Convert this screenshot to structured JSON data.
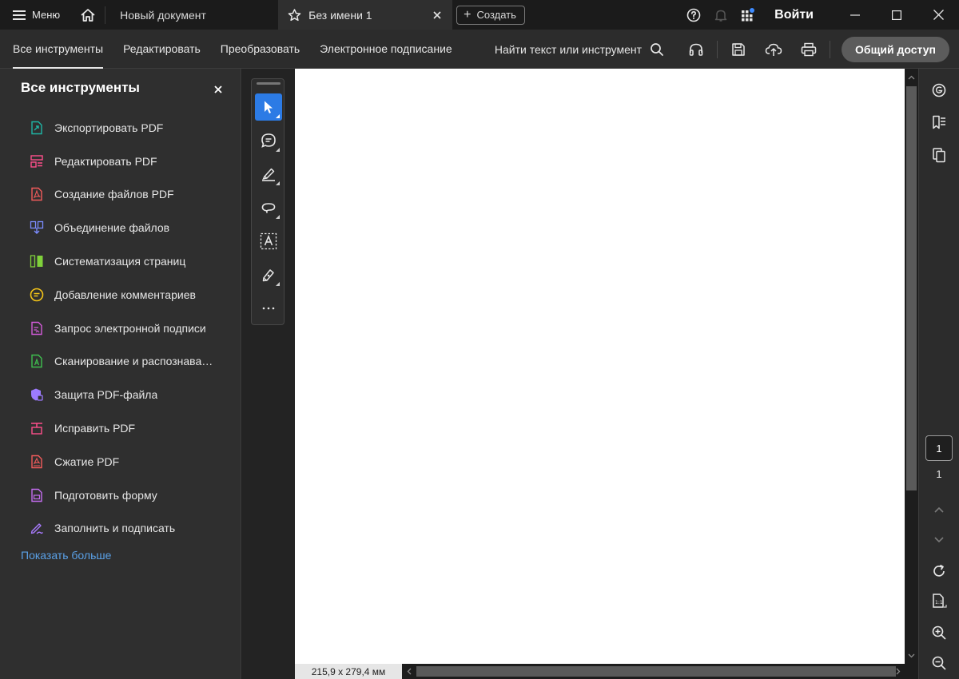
{
  "titlebar": {
    "menu_label": "Меню",
    "tabs": [
      {
        "label": "Новый документ",
        "active": false
      },
      {
        "label": "Без имени 1",
        "active": true
      }
    ],
    "create_label": "Создать",
    "login_label": "Войти",
    "icons": [
      "menu-icon",
      "home-icon",
      "star-icon",
      "close-icon",
      "help-icon",
      "bell-icon",
      "apps-icon",
      "minimize-icon",
      "maximize-icon",
      "window-close-icon"
    ]
  },
  "toolbar": {
    "tabs": [
      "Все инструменты",
      "Редактировать",
      "Преобразовать",
      "Электронное подписание"
    ],
    "active_tab": "Все инструменты",
    "find_label": "Найти текст или инструмент",
    "share_label": "Общий доступ",
    "icons": [
      "search-icon",
      "headphones-icon",
      "save-icon",
      "cloud-upload-icon",
      "print-icon"
    ]
  },
  "left_panel": {
    "title": "Все инструменты",
    "items": [
      {
        "label": "Экспортировать PDF",
        "icon": "export-pdf-icon",
        "color": "#1fb5a5"
      },
      {
        "label": "Редактировать PDF",
        "icon": "edit-pdf-icon",
        "color": "#ff4f8b"
      },
      {
        "label": "Создание файлов PDF",
        "icon": "create-pdf-icon",
        "color": "#f25b5b"
      },
      {
        "label": "Объединение файлов",
        "icon": "combine-files-icon",
        "color": "#7b8cff"
      },
      {
        "label": "Систематизация страниц",
        "icon": "organize-pages-icon",
        "color": "#7fd13b"
      },
      {
        "label": "Добавление комментариев",
        "icon": "comment-icon",
        "color": "#f5c518"
      },
      {
        "label": "Запрос электронной подписи",
        "icon": "request-signature-icon",
        "color": "#d35bd9"
      },
      {
        "label": "Сканирование и распознавание текста",
        "icon": "scan-ocr-icon",
        "color": "#3fbf4f"
      },
      {
        "label": "Защита PDF-файла",
        "icon": "protect-pdf-icon",
        "color": "#9d7bff"
      },
      {
        "label": "Исправить PDF",
        "icon": "redact-pdf-icon",
        "color": "#ff4f8b"
      },
      {
        "label": "Сжатие PDF",
        "icon": "compress-pdf-icon",
        "color": "#f25b5b"
      },
      {
        "label": "Подготовить форму",
        "icon": "prepare-form-icon",
        "color": "#c46df0"
      },
      {
        "label": "Заполнить и подписать",
        "icon": "fill-sign-icon",
        "color": "#a97bff"
      }
    ],
    "show_more_label": "Показать больше"
  },
  "tool_strip": {
    "tools": [
      "select-cursor-icon",
      "comment-bubble-icon",
      "highlighter-icon",
      "lasso-icon",
      "text-select-icon",
      "sign-pen-icon",
      "more-icon"
    ],
    "active_tool": "select-cursor-icon"
  },
  "document": {
    "page_size_label": "215,9 x 279,4 мм"
  },
  "right_rail": {
    "icons": [
      "ai-assistant-icon",
      "bookmarks-icon",
      "pages-icon",
      "chevron-up-icon",
      "chevron-down-icon",
      "rotate-icon",
      "fit-page-icon",
      "zoom-in-icon",
      "zoom-out-icon"
    ],
    "current_page": "1",
    "total_pages": "1"
  },
  "colors": {
    "accent": "#2c7be5",
    "link": "#5aa0e6",
    "notification_dot": "#3d8bff"
  }
}
